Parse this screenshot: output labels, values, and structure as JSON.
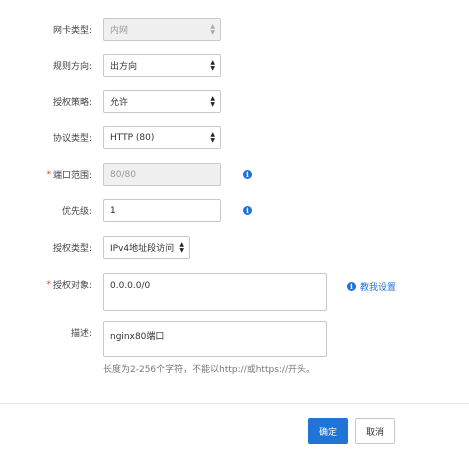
{
  "form": {
    "nic_type": {
      "label": "网卡类型:",
      "value": "内网",
      "disabled": true
    },
    "direction": {
      "label": "规则方向:",
      "value": "出方向"
    },
    "policy": {
      "label": "授权策略:",
      "value": "允许"
    },
    "protocol": {
      "label": "协议类型:",
      "value": "HTTP (80)"
    },
    "port_range": {
      "label": "端口范围:",
      "value": "80/80",
      "required": "*",
      "disabled": true,
      "info_icon": "info-icon"
    },
    "priority": {
      "label": "优先级:",
      "value": "1",
      "info_icon": "info-icon"
    },
    "auth_type": {
      "label": "授权类型:",
      "value": "IPv4地址段访问"
    },
    "auth_object": {
      "label": "授权对象:",
      "value": "0.0.0.0/0",
      "required": "*",
      "help_link": "教我设置"
    },
    "description": {
      "label": "描述:",
      "value": "nginx80端口",
      "hint": "长度为2-256个字符，不能以http://或https://开头。"
    }
  },
  "footer": {
    "confirm_label": "确定",
    "cancel_label": "取消"
  },
  "colors": {
    "accent": "#1f74d6",
    "required": "#e0412a"
  }
}
